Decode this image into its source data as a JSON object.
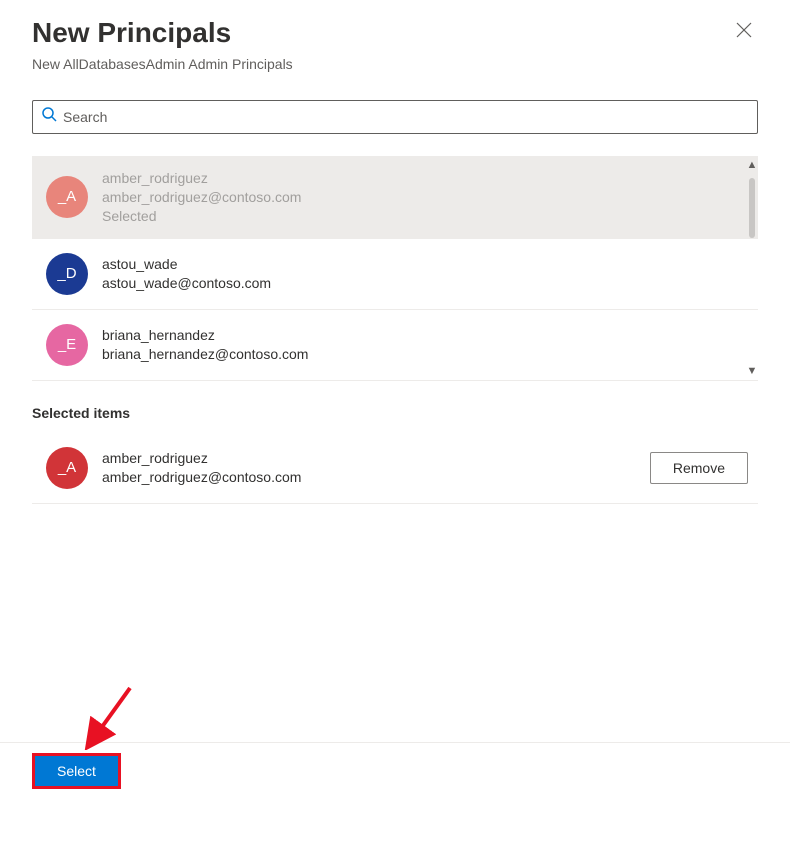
{
  "header": {
    "title": "New Principals",
    "subtitle": "New AllDatabasesAdmin Admin Principals"
  },
  "search": {
    "placeholder": "Search"
  },
  "principals": [
    {
      "name": "amber_rodriguez",
      "email": "amber_rodriguez@contoso.com",
      "status": "Selected",
      "avatar_text": "_A",
      "avatar_color": "avatar-coral",
      "selected": true
    },
    {
      "name": "astou_wade",
      "email": "astou_wade@contoso.com",
      "avatar_text": "_D",
      "avatar_color": "avatar-blue",
      "selected": false
    },
    {
      "name": "briana_hernandez",
      "email": "briana_hernandez@contoso.com",
      "avatar_text": "_E",
      "avatar_color": "avatar-pink",
      "selected": false
    }
  ],
  "selected_section": {
    "heading": "Selected items",
    "items": [
      {
        "name": "amber_rodriguez",
        "email": "amber_rodriguez@contoso.com",
        "avatar_text": "_A",
        "avatar_color": "avatar-red"
      }
    ],
    "remove_label": "Remove"
  },
  "footer": {
    "select_label": "Select"
  }
}
